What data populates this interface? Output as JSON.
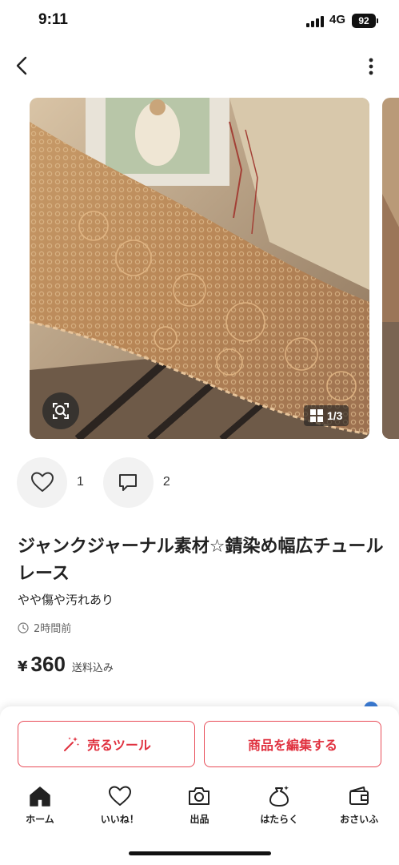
{
  "status_bar": {
    "time": "9:11",
    "network": "4G",
    "battery": "92"
  },
  "gallery": {
    "counter": "1/3",
    "icon": "image-grid-icon"
  },
  "likes": {
    "count": "1"
  },
  "comments": {
    "count": "2"
  },
  "item": {
    "title": "ジャンクジャーナル素材☆錆染め幅広チュールレース",
    "condition": "やや傷や汚れあり",
    "posted": "2時間前",
    "price_symbol": "¥",
    "price": "360",
    "shipping": "送料込み"
  },
  "actions": {
    "sell_tool": "売るツール",
    "edit": "商品を編集する"
  },
  "tabs": [
    {
      "label": "ホーム",
      "icon": "home-icon"
    },
    {
      "label": "いいね！",
      "icon": "heart-icon"
    },
    {
      "label": "出品",
      "icon": "camera-icon"
    },
    {
      "label": "はたらく",
      "icon": "money-bag-icon"
    },
    {
      "label": "おさいふ",
      "icon": "wallet-icon"
    }
  ],
  "colors": {
    "accent": "#e0313f",
    "lace": "#b98a5e"
  }
}
